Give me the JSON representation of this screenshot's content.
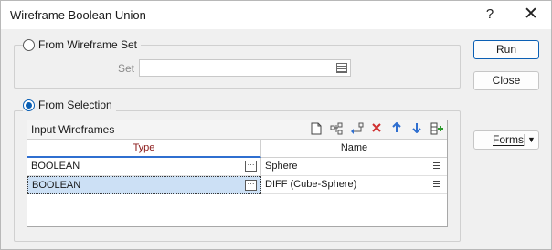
{
  "window": {
    "title": "Wireframe Boolean Union",
    "help_glyph": "?",
    "close_glyph": "✕"
  },
  "wireframe_set_group": {
    "radio_label": "From Wireframe Set",
    "selected": false,
    "set_label": "Set",
    "set_value": ""
  },
  "selection_group": {
    "radio_label": "From Selection",
    "selected": true,
    "grid": {
      "title": "Input Wireframes",
      "toolbar": [
        "new-icon",
        "add-icon",
        "insert-icon",
        "delete-icon",
        "move-up-icon",
        "move-down-icon",
        "append-icon"
      ],
      "columns": [
        "Type",
        "Name"
      ],
      "rows": [
        {
          "type": "BOOLEAN",
          "name": "Sphere"
        },
        {
          "type": "BOOLEAN",
          "name": "DIFF (Cube-Sphere)"
        }
      ],
      "selected_row": 1
    }
  },
  "actions": {
    "run": "Run",
    "close": "Close",
    "forms": "Forms",
    "forms_arrow": "▼"
  },
  "colors": {
    "accent": "#0a5fb4",
    "type_header": "#8b1a1a",
    "selected_row": "#cce0f5"
  }
}
